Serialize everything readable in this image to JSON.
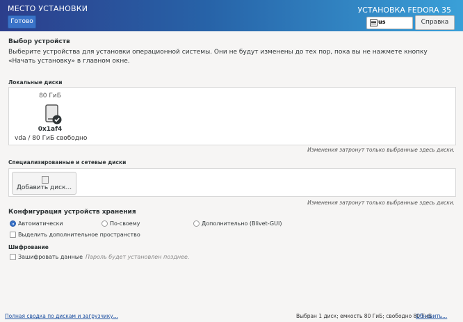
{
  "header": {
    "spoke_title": "МЕСТО УСТАНОВКИ",
    "done_label": "Готово",
    "product_title": "УСТАНОВКА FEDORA 35",
    "keyboard_layout": "us",
    "help_label": "Справка"
  },
  "device_selection": {
    "title": "Выбор устройств",
    "description": "Выберите устройства для установки операционной системы. Они не будут изменены до тех пор, пока вы не нажмете кнопку «Начать установку» в главном окне."
  },
  "local_disks": {
    "title": "Локальные диски",
    "disks": [
      {
        "size": "80 ГиБ",
        "name": "0x1af4",
        "info": "vda  /  80 ГиБ свободно"
      }
    ],
    "note": "Изменения затронут только выбранные здесь диски."
  },
  "specialized": {
    "title": "Специализированные и сетевые диски",
    "add_label": "Добавить диск...",
    "note": "Изменения затронут только выбранные здесь диски."
  },
  "storage_config": {
    "title": "Конфигурация устройств хранения",
    "options": [
      "Автоматически",
      "По-своему",
      "Дополнительно (Blivet-GUI)"
    ],
    "selected": "Автоматически",
    "reclaim_label": "Выделить дополнительное пространство"
  },
  "encryption": {
    "title": "Шифрование",
    "encrypt_label": "Зашифровать данные",
    "hint": "Пароль будет установлен позднее."
  },
  "footer": {
    "summary_link": "Полная сводка по дискам и загрузчику...",
    "status": "Выбран 1 диск; емкость 80 ГиБ; свободно 80 ГиБ",
    "refresh_link": "Обновить..."
  },
  "colors": {
    "accent": "#3a73c8",
    "link": "#1c4fa0"
  }
}
